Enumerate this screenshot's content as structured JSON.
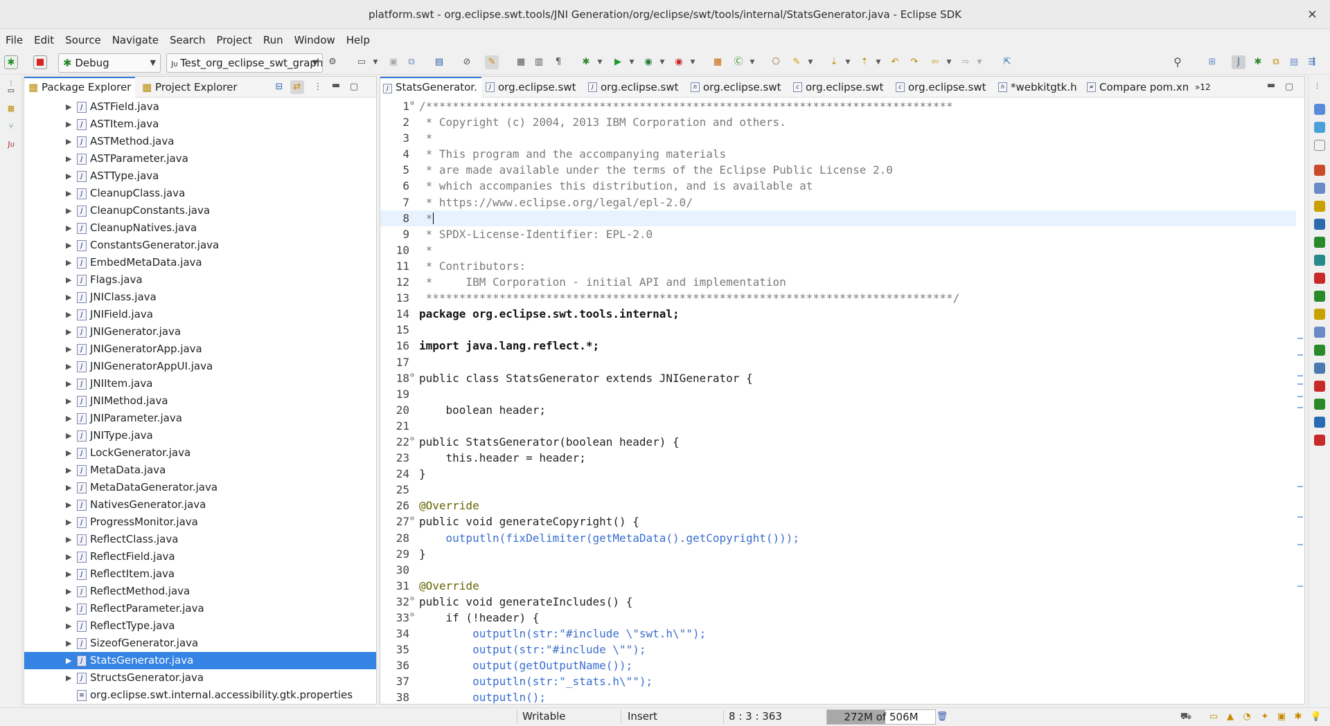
{
  "window": {
    "title": "platform.swt - org.eclipse.swt.tools/JNI Generation/org/eclipse/swt/tools/internal/StatsGenerator.java - Eclipse SDK",
    "close": "×"
  },
  "menu": [
    "File",
    "Edit",
    "Source",
    "Navigate",
    "Search",
    "Project",
    "Run",
    "Window",
    "Help"
  ],
  "toolbar": {
    "mode_combo": "Debug",
    "launch_combo": "Test_org_eclipse_swt_graph"
  },
  "explorer": {
    "tab_active": "Package Explorer",
    "tab_other": "Project Explorer",
    "files": [
      "ASTField.java",
      "ASTItem.java",
      "ASTMethod.java",
      "ASTParameter.java",
      "ASTType.java",
      "CleanupClass.java",
      "CleanupConstants.java",
      "CleanupNatives.java",
      "ConstantsGenerator.java",
      "EmbedMetaData.java",
      "Flags.java",
      "JNIClass.java",
      "JNIField.java",
      "JNIGenerator.java",
      "JNIGeneratorApp.java",
      "JNIGeneratorAppUI.java",
      "JNIItem.java",
      "JNIMethod.java",
      "JNIParameter.java",
      "JNIType.java",
      "LockGenerator.java",
      "MetaData.java",
      "MetaDataGenerator.java",
      "NativesGenerator.java",
      "ProgressMonitor.java",
      "ReflectClass.java",
      "ReflectField.java",
      "ReflectItem.java",
      "ReflectMethod.java",
      "ReflectParameter.java",
      "ReflectType.java",
      "SizeofGenerator.java",
      "StatsGenerator.java",
      "StructsGenerator.java",
      "org.eclipse.swt.internal.accessibility.gtk.properties"
    ],
    "selected": "StatsGenerator.java"
  },
  "editor_tabs": [
    "StatsGenerator.",
    "org.eclipse.swt",
    "org.eclipse.swt",
    "org.eclipse.swt",
    "org.eclipse.swt",
    "org.eclipse.swt",
    "*webkitgtk.h",
    "Compare pom.xml",
    "»12"
  ],
  "code": [
    "/*******************************************************************************",
    " * Copyright (c) 2004, 2013 IBM Corporation and others.",
    " *",
    " * This program and the accompanying materials",
    " * are made available under the terms of the Eclipse Public License 2.0",
    " * which accompanies this distribution, and is available at",
    " * https://www.eclipse.org/legal/epl-2.0/",
    " *",
    " * SPDX-License-Identifier: EPL-2.0",
    " *",
    " * Contributors:",
    " *     IBM Corporation - initial API and implementation",
    " *******************************************************************************/",
    "package org.eclipse.swt.tools.internal;",
    "",
    "import java.lang.reflect.*;",
    "",
    "public class StatsGenerator extends JNIGenerator {",
    "",
    "    boolean header;",
    "",
    "public StatsGenerator(boolean header) {",
    "    this.header = header;",
    "}",
    "",
    "@Override",
    "public void generateCopyright() {",
    "    outputln(fixDelimiter(getMetaData().getCopyright()));",
    "}",
    "",
    "@Override",
    "public void generateIncludes() {",
    "    if (!header) {",
    "        outputln(str:\"#include \\\"swt.h\\\"\");",
    "        output(str:\"#include \\\"\");",
    "        output(getOutputName());",
    "        outputln(str:\"_stats.h\\\"\");",
    "        outputln();"
  ],
  "status": {
    "writable": "Writable",
    "insert": "Insert",
    "position": "8 : 3 : 363",
    "heap": "272M of 506M",
    "heap_fraction": 0.54
  }
}
